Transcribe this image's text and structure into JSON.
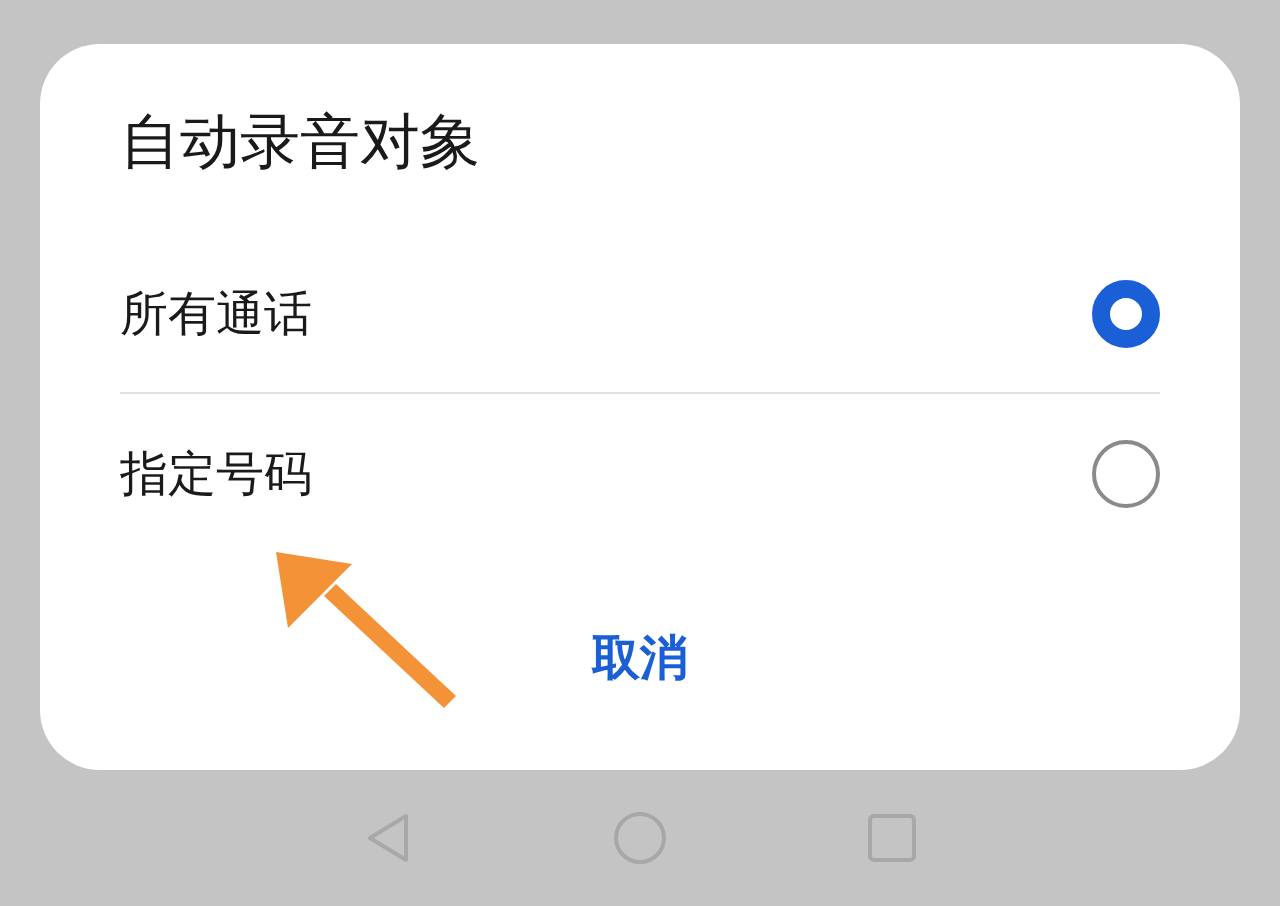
{
  "dialog": {
    "title": "自动录音对象",
    "options": [
      {
        "label": "所有通话",
        "selected": true
      },
      {
        "label": "指定号码",
        "selected": false
      }
    ],
    "cancel": "取消"
  }
}
